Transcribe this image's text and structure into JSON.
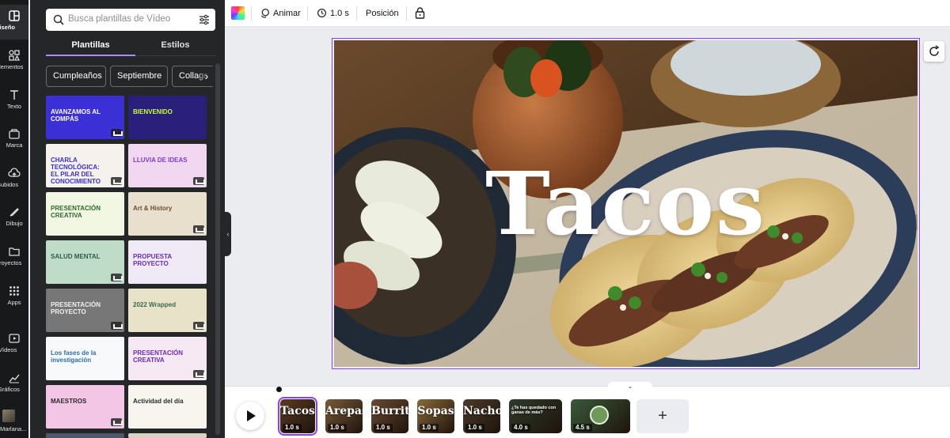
{
  "rail": {
    "items": [
      {
        "label": "Diseño",
        "icon": "layout-icon"
      },
      {
        "label": "Elementos",
        "icon": "shapes-icon"
      },
      {
        "label": "Texto",
        "icon": "text-icon"
      },
      {
        "label": "Marca",
        "icon": "brand-icon"
      },
      {
        "label": "Subidos",
        "icon": "upload-icon"
      },
      {
        "label": "Dibujo",
        "icon": "draw-icon"
      },
      {
        "label": "Proyectos",
        "icon": "folder-icon"
      },
      {
        "label": "Apps",
        "icon": "apps-icon"
      },
      {
        "label": "Vídeos",
        "icon": "video-icon"
      },
      {
        "label": "Gráficos",
        "icon": "chart-icon"
      },
      {
        "label": "Marlana...",
        "icon": "user-thumbnail"
      }
    ]
  },
  "panel": {
    "search_placeholder": "Busca plantillas de Vídeo",
    "tabs": [
      {
        "label": "Plantillas",
        "active": true
      },
      {
        "label": "Estilos",
        "active": false
      }
    ],
    "chips": [
      "Cumpleaños",
      "Septiembre",
      "Collage"
    ],
    "templates": [
      {
        "text": "AVANZAMOS AL COMPÁS",
        "bg": "#3b2fd6",
        "fg": "#ffffff"
      },
      {
        "text": "BIENVENIDO",
        "bg": "#2a1f7a",
        "fg": "#c6ff3b"
      },
      {
        "text": "CHARLA TECNOLÓGICA: EL PILAR DEL CONOCIMIENTO",
        "bg": "#f5f1ec",
        "fg": "#3b2fd6"
      },
      {
        "text": "LLUVIA DE IDEAS",
        "bg": "#f2d7f0",
        "fg": "#7a3bd6"
      },
      {
        "text": "PRESENTACIÓN CREATIVA",
        "bg": "#f1f7e2",
        "fg": "#2e6b2a"
      },
      {
        "text": "Art & History",
        "bg": "#e8dfcd",
        "fg": "#6b4e2e"
      },
      {
        "text": "SALUD MENTAL",
        "bg": "#bfdcc9",
        "fg": "#2f5d47"
      },
      {
        "text": "PROPUESTA PROYECTO",
        "bg": "#f0eaf7",
        "fg": "#6a2bbf"
      },
      {
        "text": "PRESENTACIÓN PROYECTO",
        "bg": "#777777",
        "fg": "#f0f0f0"
      },
      {
        "text": "2022 Wrapped",
        "bg": "#e8e2c8",
        "fg": "#3a6b4a"
      },
      {
        "text": "Los fases de la investigación",
        "bg": "#f7f9fb",
        "fg": "#2a6fb0"
      },
      {
        "text": "PRESENTACIÓN CREATIVA",
        "bg": "#f6e9f3",
        "fg": "#6a2bbf"
      },
      {
        "text": "MAESTROS",
        "bg": "#f3c6e6",
        "fg": "#2a2a2a"
      },
      {
        "text": "Actividad del día",
        "bg": "#f7f5ee",
        "fg": "#2a2a2a"
      }
    ]
  },
  "toolbar": {
    "animate_label": "Animar",
    "duration_label": "1.0 s",
    "position_label": "Posición"
  },
  "canvas": {
    "title": "Tacos"
  },
  "timeline": {
    "clips": [
      {
        "label": "Tacos",
        "duration": "1.0 s",
        "selected": true
      },
      {
        "label": "Arepas",
        "duration": "1.0 s",
        "selected": false
      },
      {
        "label": "Burrito",
        "duration": "1.0 s",
        "selected": false
      },
      {
        "label": "Sopas",
        "duration": "1.0 s",
        "selected": false
      },
      {
        "label": "Nachos",
        "duration": "1.0 s",
        "selected": false
      },
      {
        "label": "¿Te has quedado con ganas de más?",
        "duration": "4.0 s",
        "selected": false
      },
      {
        "label": "",
        "duration": "4.5 s",
        "selected": false
      }
    ],
    "add_label": "+"
  }
}
